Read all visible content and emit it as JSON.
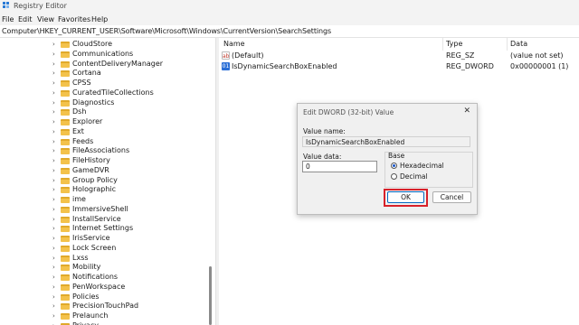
{
  "window": {
    "title": "Registry Editor"
  },
  "menu": [
    "File",
    "Edit",
    "View",
    "Favorites",
    "Help"
  ],
  "address": "Computer\\HKEY_CURRENT_USER\\Software\\Microsoft\\Windows\\CurrentVersion\\SearchSettings",
  "tree": [
    "CloudStore",
    "Communications",
    "ContentDeliveryManager",
    "Cortana",
    "CPSS",
    "CuratedTileCollections",
    "Diagnostics",
    "Dsh",
    "Explorer",
    "Ext",
    "Feeds",
    "FileAssociations",
    "FileHistory",
    "GameDVR",
    "Group Policy",
    "Holographic",
    "ime",
    "ImmersiveShell",
    "InstallService",
    "Internet Settings",
    "IrisService",
    "Lock Screen",
    "Lxss",
    "Mobility",
    "Notifications",
    "PenWorkspace",
    "Policies",
    "PrecisionTouchPad",
    "Prelaunch",
    "Privacy"
  ],
  "values": {
    "headers": {
      "name": "Name",
      "type": "Type",
      "data": "Data"
    },
    "rows": [
      {
        "name": "(Default)",
        "type": "REG_SZ",
        "data": "(value not set)",
        "icon": "string-value-icon"
      },
      {
        "name": "IsDynamicSearchBoxEnabled",
        "type": "REG_DWORD",
        "data": "0x00000001 (1)",
        "icon": "dword-value-icon"
      }
    ]
  },
  "dialog": {
    "title": "Edit DWORD (32-bit) Value",
    "value_name_label": "Value name:",
    "value_name": "IsDynamicSearchBoxEnabled",
    "value_data_label": "Value data:",
    "value_data": "0",
    "base_label": "Base",
    "base_options": [
      {
        "label": "Hexadecimal",
        "selected": true
      },
      {
        "label": "Decimal",
        "selected": false
      }
    ],
    "ok": "OK",
    "cancel": "Cancel",
    "highlight_color": "#d7212a"
  }
}
